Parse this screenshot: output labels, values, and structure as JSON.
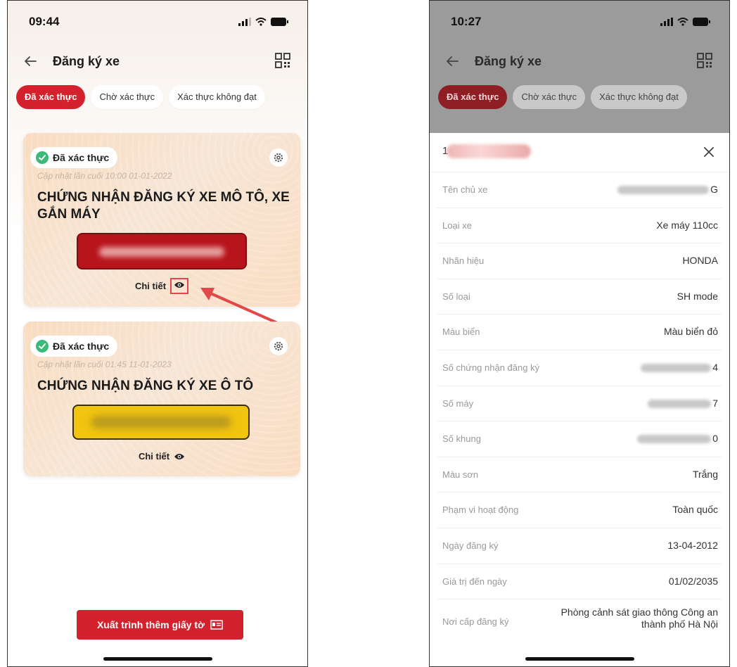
{
  "left": {
    "status_time": "09:44",
    "title": "Đăng ký xe",
    "tabs": [
      {
        "label": "Đã xác thực",
        "active": true
      },
      {
        "label": "Chờ xác thực",
        "active": false
      },
      {
        "label": "Xác thực không đạt",
        "active": false
      }
    ],
    "cards": [
      {
        "badge": "Đã xác thực",
        "updated": "Cập nhật lần cuối 10:00 01-01-2022",
        "title": "CHỨNG NHẬN ĐĂNG KÝ XE MÔ TÔ, XE GẮN MÁY",
        "plate_color": "#b8141b",
        "detail": "Chi tiết"
      },
      {
        "badge": "Đã xác thực",
        "updated": "Cập nhật lần cuối 01:45 11-01-2023",
        "title": "CHỨNG NHẬN ĐĂNG KÝ XE Ô TÔ",
        "plate_color": "#f1c40f",
        "detail": "Chi tiết"
      }
    ],
    "export_button": "Xuất trình thêm giấy tờ"
  },
  "right": {
    "status_time": "10:27",
    "title": "Đăng ký xe",
    "tabs": [
      {
        "label": "Đã xác thực",
        "active": true
      },
      {
        "label": "Chờ xác thực",
        "active": false
      },
      {
        "label": "Xác thực không đạt",
        "active": false
      }
    ],
    "header_plate_prefix": "1",
    "fields": [
      {
        "label": "Tên chủ xe",
        "value": "G"
      },
      {
        "label": "Loại xe",
        "value": "Xe máy 110cc"
      },
      {
        "label": "Nhãn hiệu",
        "value": "HONDA"
      },
      {
        "label": "Số loại",
        "value": "SH mode"
      },
      {
        "label": "Màu biển",
        "value": "Màu biển đỏ"
      },
      {
        "label": "Số chứng nhận đăng ký",
        "value": "4"
      },
      {
        "label": "Số máy",
        "value": "7"
      },
      {
        "label": "Số khung",
        "value": "0"
      },
      {
        "label": "Màu sơn",
        "value": "Trắng"
      },
      {
        "label": "Phạm vi hoạt động",
        "value": "Toàn quốc"
      },
      {
        "label": "Ngày đăng ký",
        "value": "13-04-2012"
      },
      {
        "label": "Giá trị đến ngày",
        "value": "01/02/2035"
      },
      {
        "label": "Nơi cấp đăng ký",
        "value": "Phòng cảnh sát giao thông Công an thành phố Hà Nội"
      }
    ]
  },
  "colors": {
    "primary_red": "#d3222d",
    "verified_green": "#3cb878",
    "annotation_red": "#e0484a"
  }
}
